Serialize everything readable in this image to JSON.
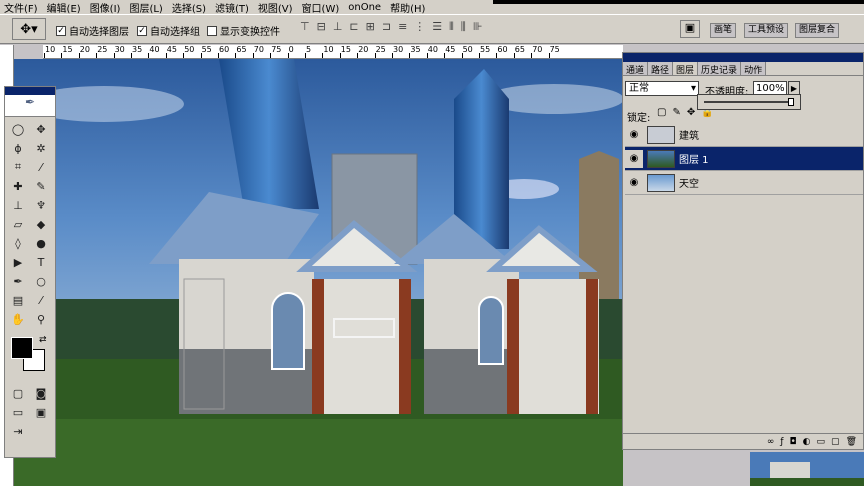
{
  "menu": [
    "文件(F)",
    "编辑(E)",
    "图像(I)",
    "图层(L)",
    "选择(S)",
    "滤镜(T)",
    "视图(V)",
    "窗口(W)",
    "onOne",
    "帮助(H)"
  ],
  "options": {
    "auto_select_layer": "自动选择图层",
    "auto_select_group": "自动选择组",
    "show_transform": "显示变换控件",
    "auto_select_layer_checked": true,
    "auto_select_group_checked": true,
    "show_transform_checked": false
  },
  "top_tabs": [
    "画笔",
    "工具预设",
    "图层复合"
  ],
  "ruler": [
    "10",
    "15",
    "20",
    "25",
    "30",
    "35",
    "40",
    "45",
    "50",
    "55",
    "60",
    "65",
    "70",
    "75",
    "0",
    "5",
    "10",
    "15",
    "20",
    "25",
    "30",
    "35",
    "40",
    "45",
    "50",
    "55",
    "60",
    "65",
    "70",
    "75"
  ],
  "panel": {
    "tabs": [
      "通道",
      "路径",
      "图层",
      "历史记录",
      "动作"
    ],
    "active_tab": "图层",
    "blend_mode": "正常",
    "opacity_label": "不透明度:",
    "opacity_value": "100%",
    "lock_label": "锁定:",
    "layers": [
      {
        "name": "建筑",
        "selected": false
      },
      {
        "name": "图层 1",
        "selected": true
      },
      {
        "name": "天空",
        "selected": false
      }
    ]
  },
  "colors": {
    "title_bar": "#0a246a",
    "selection": "#0a246a",
    "sky": "#3a6cb0",
    "grass": "#2f5a22"
  }
}
